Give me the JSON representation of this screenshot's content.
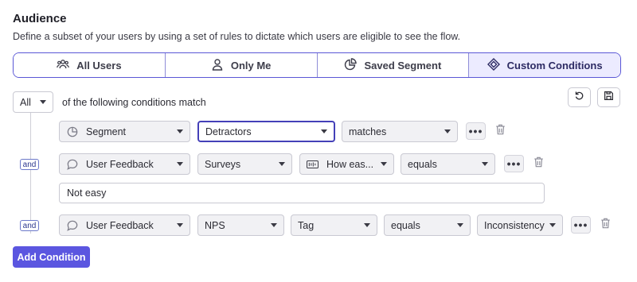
{
  "audience": {
    "title": "Audience",
    "description": "Define a subset of your users by using a set of rules to dictate which users are eligible to see the flow."
  },
  "segment_options": [
    {
      "label": "All Users",
      "icon": "users-icon"
    },
    {
      "label": "Only Me",
      "icon": "user-icon"
    },
    {
      "label": "Saved Segment",
      "icon": "pie-chart-icon"
    },
    {
      "label": "Custom Conditions",
      "icon": "diamond-icon",
      "selected": true
    }
  ],
  "match": {
    "quantifier": "All",
    "text": "of the following conditions match"
  },
  "conditions": [
    {
      "property": "Segment",
      "value": "Detractors",
      "operator": "matches"
    },
    {
      "connector": "and",
      "property": "User Feedback",
      "source": "Surveys",
      "question": "How eas...",
      "operator": "equals",
      "input_value": "Not easy"
    },
    {
      "connector": "and",
      "property": "User Feedback",
      "source": "NPS",
      "field": "Tag",
      "operator": "equals",
      "value": "Inconsistency"
    }
  ],
  "actions": {
    "more": "•••",
    "add_condition": "Add Condition"
  },
  "colors": {
    "accent": "#5b56e0",
    "selected_bg": "#ecebff",
    "border": "#c9c9d2"
  }
}
